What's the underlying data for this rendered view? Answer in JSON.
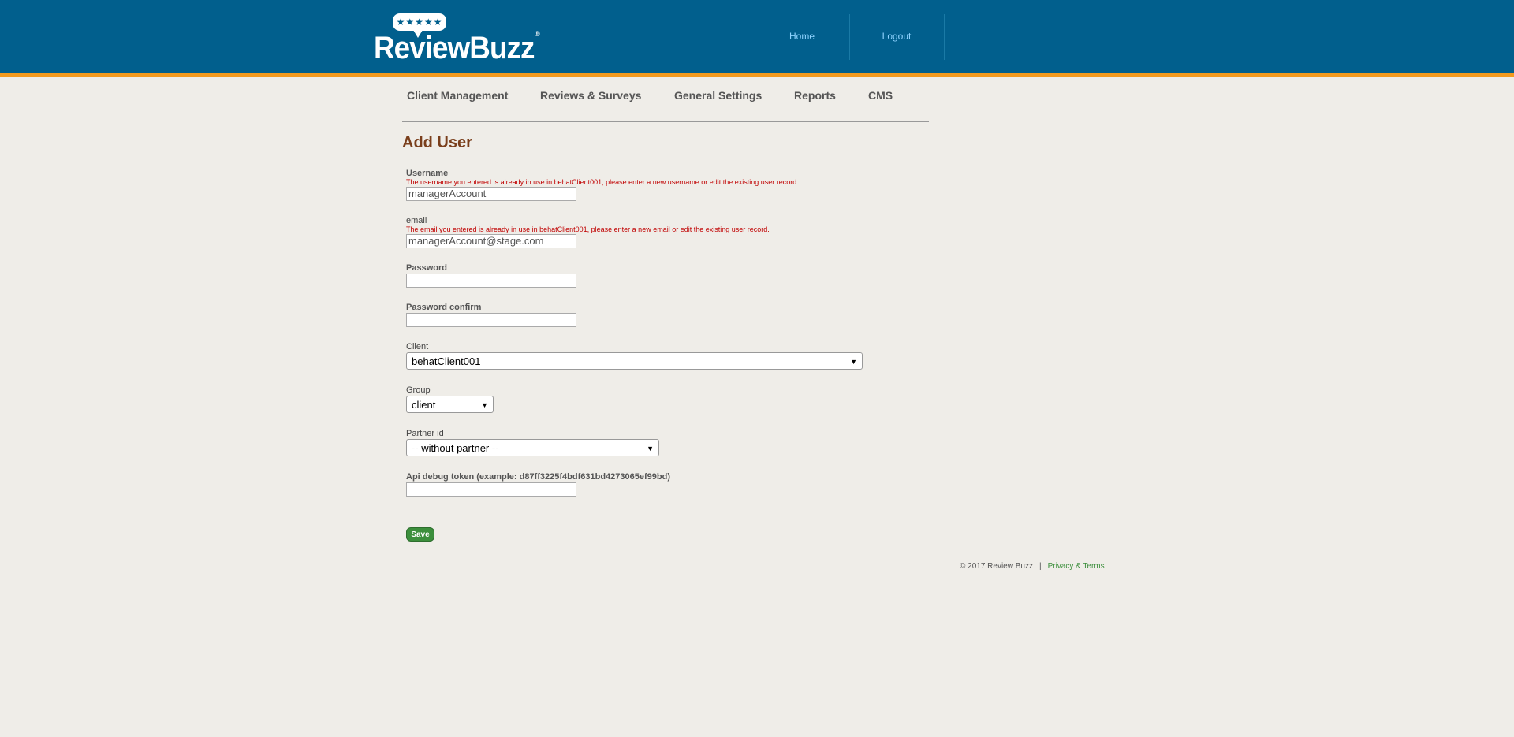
{
  "brand": {
    "name": "ReviewBuzz",
    "stars": "★★★★★",
    "reg": "®"
  },
  "topnav": {
    "home": "Home",
    "logout": "Logout"
  },
  "mainnav": [
    "Client Management",
    "Reviews & Surveys",
    "General Settings",
    "Reports",
    "CMS"
  ],
  "page": {
    "title": "Add User"
  },
  "form": {
    "username": {
      "label": "Username",
      "error": "The username you entered is already in use in behatClient001, please enter a new username or edit the existing user record.",
      "value": "managerAccount"
    },
    "email": {
      "label": "email",
      "error": "The email you entered is already in use in behatClient001, please enter a new email or edit the existing user record.",
      "value": "managerAccount@stage.com"
    },
    "password": {
      "label": "Password",
      "value": ""
    },
    "password_confirm": {
      "label": "Password confirm",
      "value": ""
    },
    "client": {
      "label": "Client",
      "value": "behatClient001"
    },
    "group": {
      "label": "Group",
      "value": "client"
    },
    "partner": {
      "label": "Partner id",
      "value": "-- without partner --"
    },
    "api_token": {
      "label": "Api debug token (example: d87ff3225f4bdf631bd4273065ef99bd)",
      "value": ""
    },
    "save_label": "Save"
  },
  "footer": {
    "copyright": "© 2017 Review Buzz",
    "separator": "|",
    "privacy": "Privacy & Terms"
  }
}
